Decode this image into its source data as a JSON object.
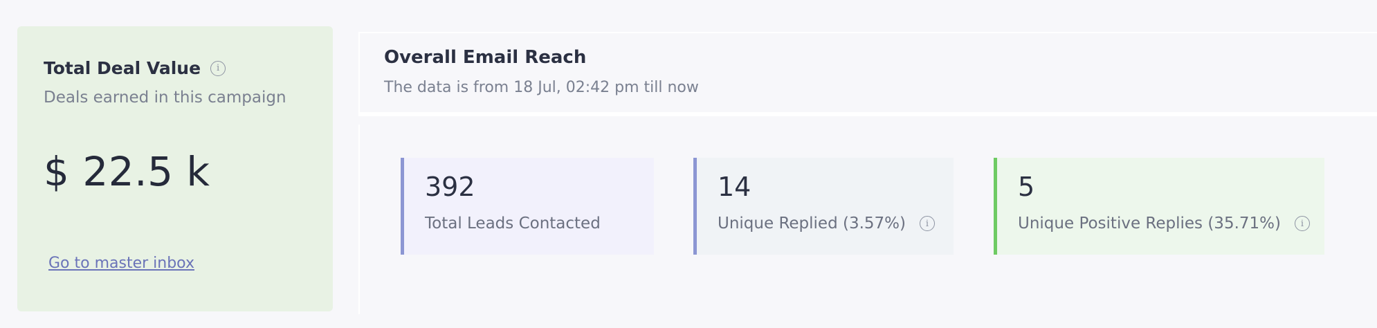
{
  "deal_card": {
    "title": "Total Deal Value",
    "info_icon": "info-icon",
    "subtitle": "Deals earned in this campaign",
    "value": "$ 22.5 k",
    "link": "Go to master inbox"
  },
  "reach": {
    "title": "Overall Email Reach",
    "subtitle": "The data is from 18 Jul, 02:42 pm till now",
    "stats": [
      {
        "value": "392",
        "label": "Total Leads Contacted",
        "accent": "#8c96d3"
      },
      {
        "value": "14",
        "label": "Unique Replied (3.57%)",
        "accent": "#8c96d3",
        "info_icon": "info-icon"
      },
      {
        "value": "5",
        "label": "Unique Positive Replies (35.71%)",
        "accent": "#6ecb63",
        "info_icon": "info-icon"
      }
    ]
  },
  "colors": {
    "deal_card_bg": "#e8f2e4",
    "link": "#6a73b8"
  }
}
